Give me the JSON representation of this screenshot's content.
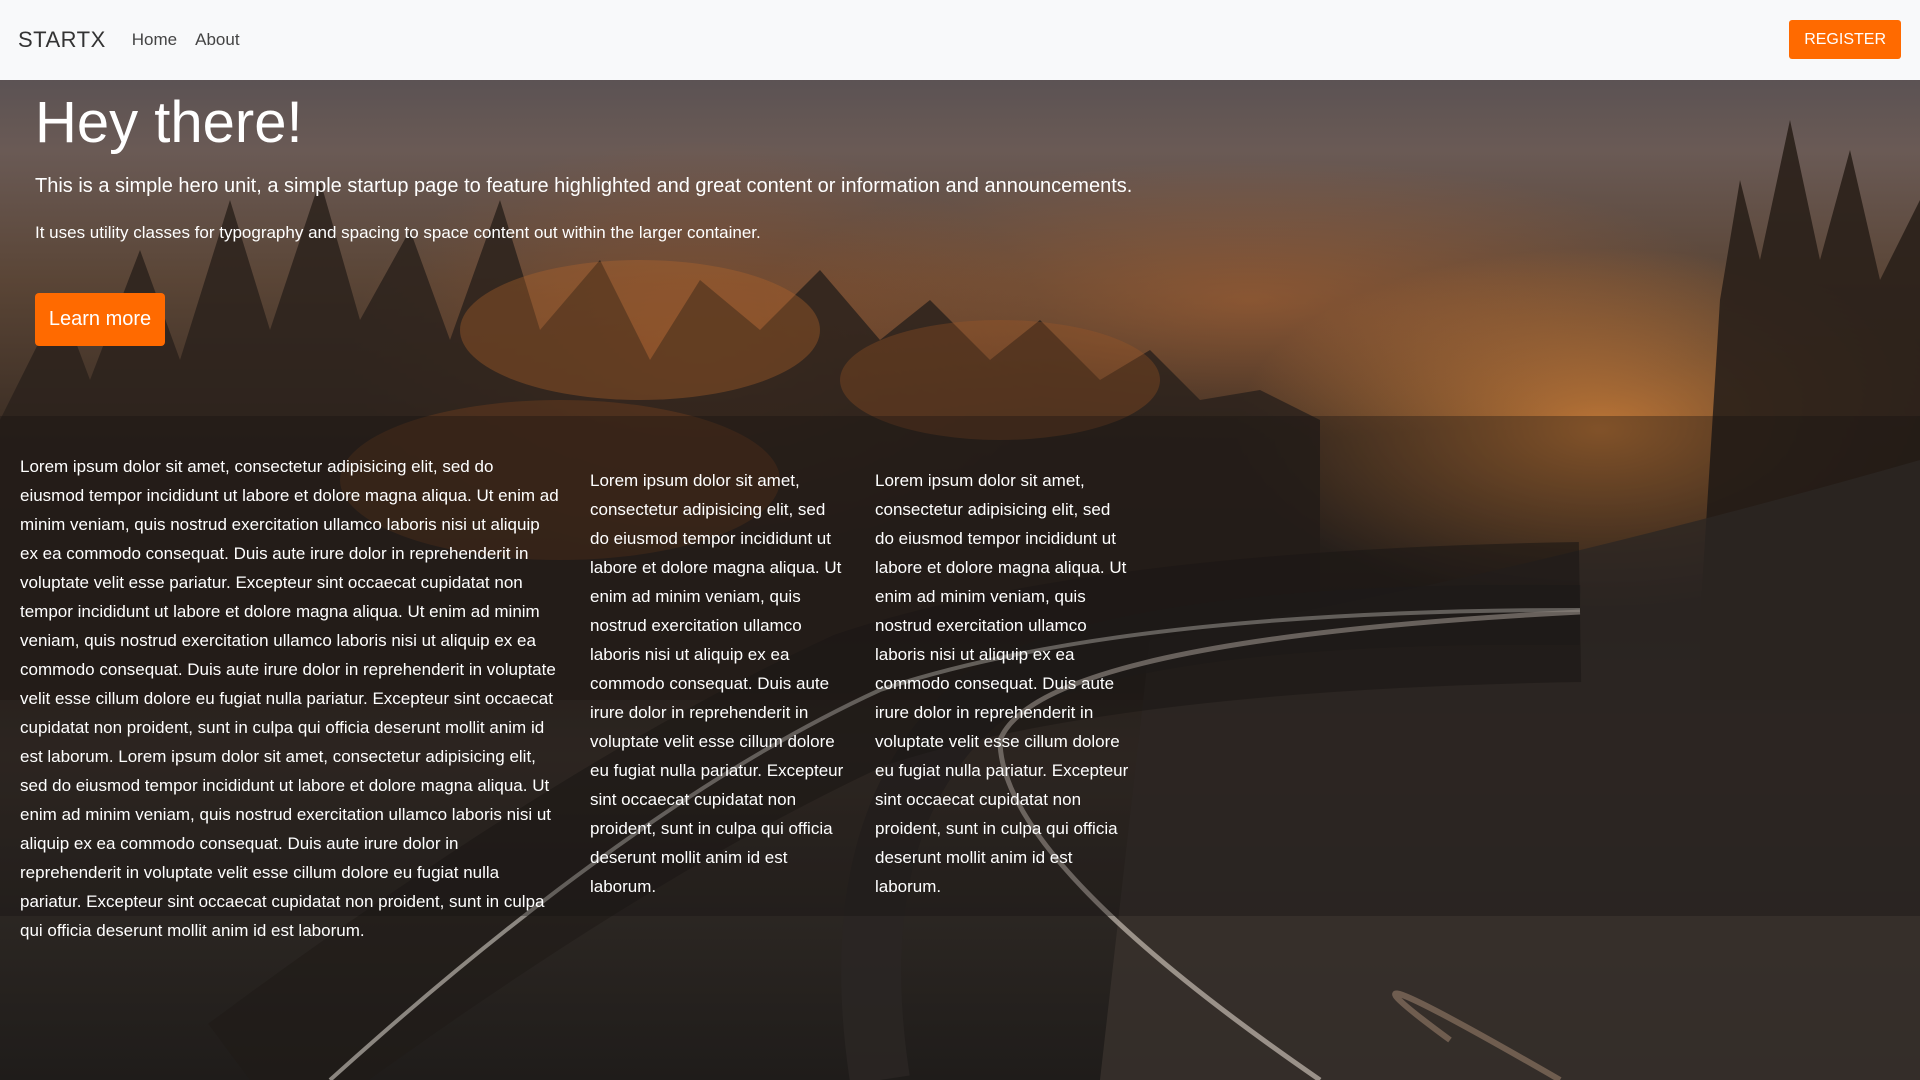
{
  "navbar": {
    "brand": "STARTX",
    "links": [
      "Home",
      "About"
    ],
    "register_label": "REGISTER"
  },
  "hero": {
    "title": "Hey there!",
    "lead": "This is a simple hero unit, a simple startup page to feature highlighted and great content or information and announcements.",
    "sub": "It uses utility classes for typography and spacing to space content out within the larger container.",
    "button_label": "Learn more"
  },
  "columns": [
    "Lorem ipsum dolor sit amet, consectetur adipisicing elit, sed do eiusmod tempor incididunt ut labore et dolore magna aliqua. Ut enim ad minim veniam, quis nostrud exercitation ullamco laboris nisi ut aliquip ex ea commodo consequat. Duis aute irure dolor in reprehenderit in voluptate velit esse pariatur. Excepteur sint occaecat cupidatat non tempor incididunt ut labore et dolore magna aliqua. Ut enim ad minim veniam, quis nostrud exercitation ullamco laboris nisi ut aliquip ex ea commodo consequat. Duis aute irure dolor in reprehenderit in voluptate velit esse cillum dolore eu fugiat nulla pariatur. Excepteur sint occaecat cupidatat non proident, sunt in culpa qui officia deserunt mollit anim id est laborum. Lorem ipsum dolor sit amet, consectetur adipisicing elit, sed do eiusmod tempor incididunt ut labore et dolore magna aliqua. Ut enim ad minim veniam, quis nostrud exercitation ullamco laboris nisi ut aliquip ex ea commodo consequat. Duis aute irure dolor in reprehenderit in voluptate velit esse cillum dolore eu fugiat nulla pariatur. Excepteur sint occaecat cupidatat non proident, sunt in culpa qui officia deserunt mollit anim id est laborum.",
    "Lorem ipsum dolor sit amet, consectetur adipisicing elit, sed do eiusmod tempor incididunt ut labore et dolore magna aliqua. Ut enim ad minim veniam, quis nostrud exercitation ullamco laboris nisi ut aliquip ex ea commodo consequat. Duis aute irure dolor in reprehenderit in voluptate velit esse cillum dolore eu fugiat nulla pariatur. Excepteur sint occaecat cupidatat non proident, sunt in culpa qui officia deserunt mollit anim id est laborum.",
    "Lorem ipsum dolor sit amet, consectetur adipisicing elit, sed do eiusmod tempor incididunt ut labore et dolore magna aliqua. Ut enim ad minim veniam, quis nostrud exercitation ullamco laboris nisi ut aliquip ex ea commodo consequat. Duis aute irure dolor in reprehenderit in voluptate velit esse cillum dolore eu fugiat nulla pariatur. Excepteur sint occaecat cupidatat non proident, sunt in culpa qui officia deserunt mollit anim id est laborum."
  ],
  "colors": {
    "accent": "#ff6a00",
    "navbar_bg": "#f8f9fa"
  }
}
